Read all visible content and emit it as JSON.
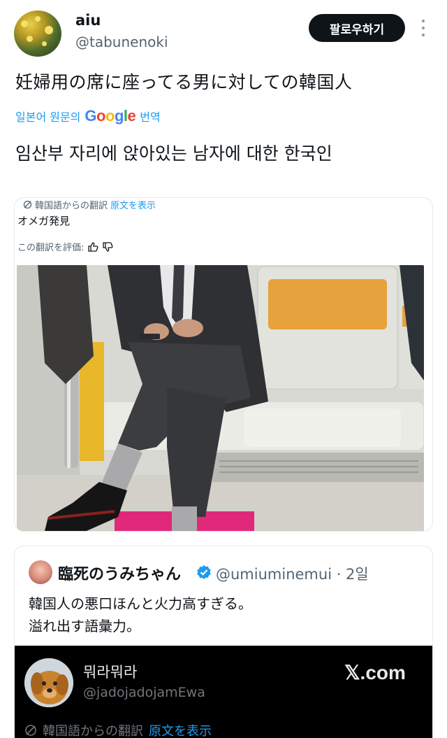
{
  "author": {
    "name": "aiu",
    "handle": "@tabunenoki"
  },
  "follow_button": "팔로우하기",
  "tweet": {
    "text": "妊婦用の席に座ってる男に対しての韓国人",
    "translate_prefix": "일본어 원문의",
    "translate_logo": "Google",
    "translate_suffix": "번역",
    "translated": "임산부 자리에 앉아있는 남자에 대한 한국인"
  },
  "embedded": {
    "translation_label": "韓国語からの翻訳",
    "show_original": "原文を表示",
    "body": "オメガ発見",
    "rate_label": "この翻訳を評価:"
  },
  "quote": {
    "name": "臨死のうみちゃん",
    "handle_time": "@umiuminemui · 2일",
    "text_line1": "韓国人の悪口ほんと火力高すぎる。",
    "text_line2": "溢れ出す語彙力。"
  },
  "inner_card": {
    "name": "뭐라뭐라",
    "handle": "@jadojadojamEwa",
    "brand": "𝕏.com",
    "translation_label": "韓国語からの翻訳",
    "show_original": "原文を表示"
  },
  "colors": {
    "link": "#1d9bf0",
    "follow_bg": "#0f1419",
    "seat_accent": "#e6a23c",
    "floor_pink": "#e0287a"
  },
  "icons": {
    "more": "more-vertical-icon",
    "verified": "verified-badge-icon",
    "translate": "translate-icon",
    "thumbs_up": "thumbs-up-icon",
    "thumbs_down": "thumbs-down-icon"
  }
}
